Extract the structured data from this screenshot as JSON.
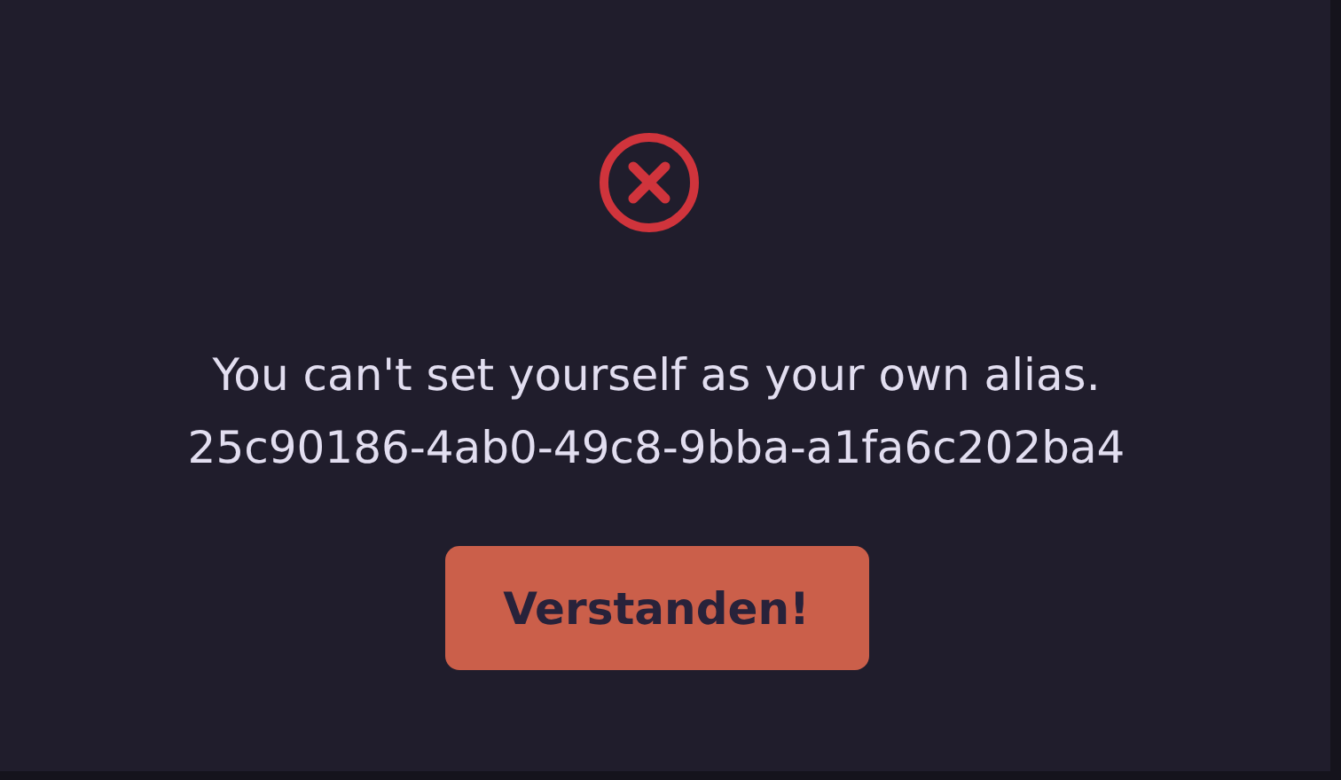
{
  "dialog": {
    "message": "You can't set yourself as your own alias.",
    "detail": "25c90186-4ab0-49c8-9bba-a1fa6c202ba4",
    "button": "Verstanden!"
  }
}
